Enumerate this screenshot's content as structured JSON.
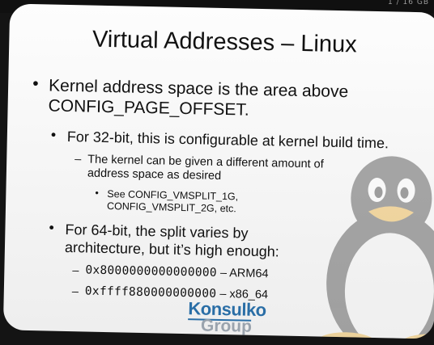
{
  "top_strip_text": "1 / 16 GB",
  "slide": {
    "title": "Virtual Addresses – Linux",
    "bullets": [
      {
        "line1": "Kernel address space is the area above",
        "line2": "CONFIG_PAGE_OFFSET."
      },
      {
        "line1": "For 32-bit, this is configurable at kernel build time."
      },
      {
        "line1": "The kernel can be given a different amount of",
        "line2": "address space as desired"
      },
      {
        "line1": "See CONFIG_VMSPLIT_1G,",
        "line2": "CONFIG_VMSPLIT_2G, etc."
      },
      {
        "line1": "For 64-bit, the split varies by",
        "line2": "architecture, but it’s high enough:"
      },
      {
        "code": "0x8000000000000000",
        "text": " – ARM64"
      },
      {
        "code": "0xffff880000000000",
        "text": " – x86_64"
      }
    ],
    "markers": {
      "bullet": "•",
      "dash": "–"
    }
  },
  "logo": {
    "main": "Konsulko",
    "sub": "Group"
  },
  "colors": {
    "logo_blue": "#2a6ea6",
    "logo_gray": "#9aa3ad",
    "slide_bg": "#f8f8f8"
  }
}
